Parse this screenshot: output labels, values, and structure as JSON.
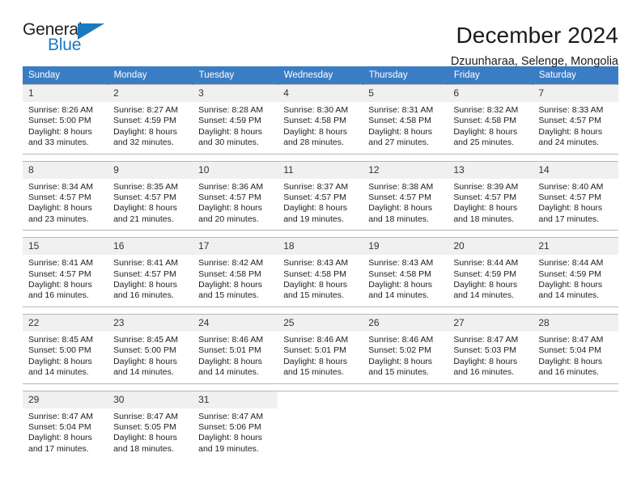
{
  "brand": {
    "name_top": "General",
    "name_bottom": "Blue",
    "triangle_icon": "triangle-icon",
    "color_dark": "#231f20",
    "color_blue": "#1c79c0"
  },
  "header": {
    "title": "December 2024",
    "subtitle": "Dzuunharaa, Selenge, Mongolia"
  },
  "calendar": {
    "accent_color": "#3b7dc4",
    "daynum_bg": "#f0f0f0",
    "weekday_headers": [
      "Sunday",
      "Monday",
      "Tuesday",
      "Wednesday",
      "Thursday",
      "Friday",
      "Saturday"
    ],
    "weeks": [
      [
        {
          "day": "1",
          "sunrise": "Sunrise: 8:26 AM",
          "sunset": "Sunset: 5:00 PM",
          "daylight_1": "Daylight: 8 hours",
          "daylight_2": "and 33 minutes."
        },
        {
          "day": "2",
          "sunrise": "Sunrise: 8:27 AM",
          "sunset": "Sunset: 4:59 PM",
          "daylight_1": "Daylight: 8 hours",
          "daylight_2": "and 32 minutes."
        },
        {
          "day": "3",
          "sunrise": "Sunrise: 8:28 AM",
          "sunset": "Sunset: 4:59 PM",
          "daylight_1": "Daylight: 8 hours",
          "daylight_2": "and 30 minutes."
        },
        {
          "day": "4",
          "sunrise": "Sunrise: 8:30 AM",
          "sunset": "Sunset: 4:58 PM",
          "daylight_1": "Daylight: 8 hours",
          "daylight_2": "and 28 minutes."
        },
        {
          "day": "5",
          "sunrise": "Sunrise: 8:31 AM",
          "sunset": "Sunset: 4:58 PM",
          "daylight_1": "Daylight: 8 hours",
          "daylight_2": "and 27 minutes."
        },
        {
          "day": "6",
          "sunrise": "Sunrise: 8:32 AM",
          "sunset": "Sunset: 4:58 PM",
          "daylight_1": "Daylight: 8 hours",
          "daylight_2": "and 25 minutes."
        },
        {
          "day": "7",
          "sunrise": "Sunrise: 8:33 AM",
          "sunset": "Sunset: 4:57 PM",
          "daylight_1": "Daylight: 8 hours",
          "daylight_2": "and 24 minutes."
        }
      ],
      [
        {
          "day": "8",
          "sunrise": "Sunrise: 8:34 AM",
          "sunset": "Sunset: 4:57 PM",
          "daylight_1": "Daylight: 8 hours",
          "daylight_2": "and 23 minutes."
        },
        {
          "day": "9",
          "sunrise": "Sunrise: 8:35 AM",
          "sunset": "Sunset: 4:57 PM",
          "daylight_1": "Daylight: 8 hours",
          "daylight_2": "and 21 minutes."
        },
        {
          "day": "10",
          "sunrise": "Sunrise: 8:36 AM",
          "sunset": "Sunset: 4:57 PM",
          "daylight_1": "Daylight: 8 hours",
          "daylight_2": "and 20 minutes."
        },
        {
          "day": "11",
          "sunrise": "Sunrise: 8:37 AM",
          "sunset": "Sunset: 4:57 PM",
          "daylight_1": "Daylight: 8 hours",
          "daylight_2": "and 19 minutes."
        },
        {
          "day": "12",
          "sunrise": "Sunrise: 8:38 AM",
          "sunset": "Sunset: 4:57 PM",
          "daylight_1": "Daylight: 8 hours",
          "daylight_2": "and 18 minutes."
        },
        {
          "day": "13",
          "sunrise": "Sunrise: 8:39 AM",
          "sunset": "Sunset: 4:57 PM",
          "daylight_1": "Daylight: 8 hours",
          "daylight_2": "and 18 minutes."
        },
        {
          "day": "14",
          "sunrise": "Sunrise: 8:40 AM",
          "sunset": "Sunset: 4:57 PM",
          "daylight_1": "Daylight: 8 hours",
          "daylight_2": "and 17 minutes."
        }
      ],
      [
        {
          "day": "15",
          "sunrise": "Sunrise: 8:41 AM",
          "sunset": "Sunset: 4:57 PM",
          "daylight_1": "Daylight: 8 hours",
          "daylight_2": "and 16 minutes."
        },
        {
          "day": "16",
          "sunrise": "Sunrise: 8:41 AM",
          "sunset": "Sunset: 4:57 PM",
          "daylight_1": "Daylight: 8 hours",
          "daylight_2": "and 16 minutes."
        },
        {
          "day": "17",
          "sunrise": "Sunrise: 8:42 AM",
          "sunset": "Sunset: 4:58 PM",
          "daylight_1": "Daylight: 8 hours",
          "daylight_2": "and 15 minutes."
        },
        {
          "day": "18",
          "sunrise": "Sunrise: 8:43 AM",
          "sunset": "Sunset: 4:58 PM",
          "daylight_1": "Daylight: 8 hours",
          "daylight_2": "and 15 minutes."
        },
        {
          "day": "19",
          "sunrise": "Sunrise: 8:43 AM",
          "sunset": "Sunset: 4:58 PM",
          "daylight_1": "Daylight: 8 hours",
          "daylight_2": "and 14 minutes."
        },
        {
          "day": "20",
          "sunrise": "Sunrise: 8:44 AM",
          "sunset": "Sunset: 4:59 PM",
          "daylight_1": "Daylight: 8 hours",
          "daylight_2": "and 14 minutes."
        },
        {
          "day": "21",
          "sunrise": "Sunrise: 8:44 AM",
          "sunset": "Sunset: 4:59 PM",
          "daylight_1": "Daylight: 8 hours",
          "daylight_2": "and 14 minutes."
        }
      ],
      [
        {
          "day": "22",
          "sunrise": "Sunrise: 8:45 AM",
          "sunset": "Sunset: 5:00 PM",
          "daylight_1": "Daylight: 8 hours",
          "daylight_2": "and 14 minutes."
        },
        {
          "day": "23",
          "sunrise": "Sunrise: 8:45 AM",
          "sunset": "Sunset: 5:00 PM",
          "daylight_1": "Daylight: 8 hours",
          "daylight_2": "and 14 minutes."
        },
        {
          "day": "24",
          "sunrise": "Sunrise: 8:46 AM",
          "sunset": "Sunset: 5:01 PM",
          "daylight_1": "Daylight: 8 hours",
          "daylight_2": "and 14 minutes."
        },
        {
          "day": "25",
          "sunrise": "Sunrise: 8:46 AM",
          "sunset": "Sunset: 5:01 PM",
          "daylight_1": "Daylight: 8 hours",
          "daylight_2": "and 15 minutes."
        },
        {
          "day": "26",
          "sunrise": "Sunrise: 8:46 AM",
          "sunset": "Sunset: 5:02 PM",
          "daylight_1": "Daylight: 8 hours",
          "daylight_2": "and 15 minutes."
        },
        {
          "day": "27",
          "sunrise": "Sunrise: 8:47 AM",
          "sunset": "Sunset: 5:03 PM",
          "daylight_1": "Daylight: 8 hours",
          "daylight_2": "and 16 minutes."
        },
        {
          "day": "28",
          "sunrise": "Sunrise: 8:47 AM",
          "sunset": "Sunset: 5:04 PM",
          "daylight_1": "Daylight: 8 hours",
          "daylight_2": "and 16 minutes."
        }
      ],
      [
        {
          "day": "29",
          "sunrise": "Sunrise: 8:47 AM",
          "sunset": "Sunset: 5:04 PM",
          "daylight_1": "Daylight: 8 hours",
          "daylight_2": "and 17 minutes."
        },
        {
          "day": "30",
          "sunrise": "Sunrise: 8:47 AM",
          "sunset": "Sunset: 5:05 PM",
          "daylight_1": "Daylight: 8 hours",
          "daylight_2": "and 18 minutes."
        },
        {
          "day": "31",
          "sunrise": "Sunrise: 8:47 AM",
          "sunset": "Sunset: 5:06 PM",
          "daylight_1": "Daylight: 8 hours",
          "daylight_2": "and 19 minutes."
        },
        {
          "day": "",
          "sunrise": "",
          "sunset": "",
          "daylight_1": "",
          "daylight_2": ""
        },
        {
          "day": "",
          "sunrise": "",
          "sunset": "",
          "daylight_1": "",
          "daylight_2": ""
        },
        {
          "day": "",
          "sunrise": "",
          "sunset": "",
          "daylight_1": "",
          "daylight_2": ""
        },
        {
          "day": "",
          "sunrise": "",
          "sunset": "",
          "daylight_1": "",
          "daylight_2": ""
        }
      ]
    ]
  }
}
